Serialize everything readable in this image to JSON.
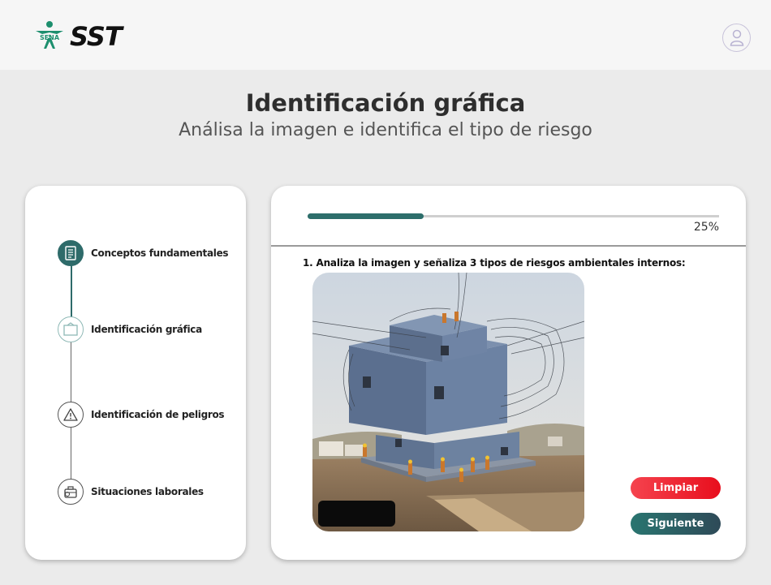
{
  "header": {
    "logo_small": "SENA",
    "logo_text": "SST",
    "user_icon": "user-icon"
  },
  "page": {
    "title": "Identificación gráfica",
    "subtitle": "Análisa la imagen e identifica el tipo de riesgo"
  },
  "sidebar": {
    "steps": [
      {
        "label": "Conceptos fundamentales",
        "icon": "document-icon",
        "state": "completed"
      },
      {
        "label": "Identificación gráfica",
        "icon": "picture-frame-icon",
        "state": "current"
      },
      {
        "label": "Identificación de peligros",
        "icon": "warning-icon",
        "state": "pending"
      },
      {
        "label": "Situaciones laborales",
        "icon": "toolbox-icon",
        "state": "pending"
      }
    ]
  },
  "quiz": {
    "progress": 0.25,
    "progress_label": "25%",
    "question": "1. Analiza la imagen y señaliza 3 tipos de riesgos ambientales internos:",
    "image_icon": "construction-site-image",
    "clear_label": "Limpiar",
    "next_label": "Siguiente"
  },
  "colors": {
    "accent": "#2e6b6a",
    "danger": "#f0212d",
    "background": "#ebebeb"
  }
}
